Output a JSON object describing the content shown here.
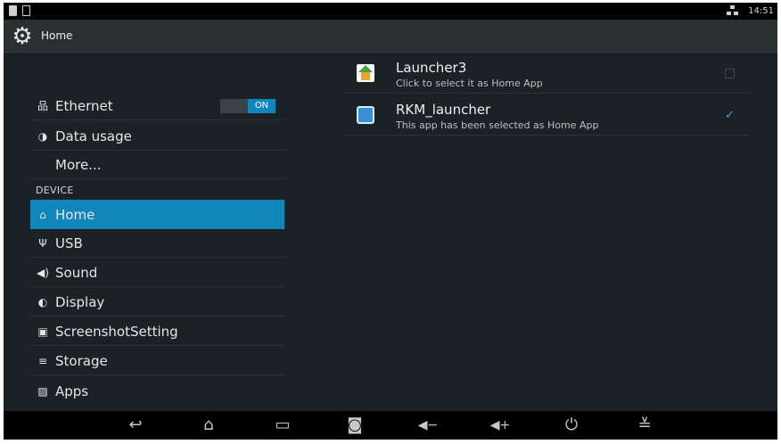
{
  "status_bar": {
    "left_icons": [
      "sd-card-icon",
      "image-notification-icon"
    ],
    "network_icon": "ethernet-icon",
    "time": "14:51"
  },
  "action_bar": {
    "icon": "settings-gear-icon",
    "title": "Home"
  },
  "settings_list": {
    "items": [
      {
        "icon": "ethernet-icon",
        "glyph": "品",
        "label": "Ethernet",
        "toggle": "ON"
      },
      {
        "icon": "data-usage-icon",
        "glyph": "◑",
        "label": "Data usage"
      },
      {
        "icon": "",
        "glyph": "",
        "label": "More..."
      }
    ],
    "device_header": "DEVICE",
    "device_items": [
      {
        "icon": "home-icon",
        "glyph": "⌂",
        "label": "Home",
        "selected": true
      },
      {
        "icon": "usb-icon",
        "glyph": "Ψ",
        "label": "USB"
      },
      {
        "icon": "sound-icon",
        "glyph": "◀)",
        "label": "Sound"
      },
      {
        "icon": "display-icon",
        "glyph": "◐",
        "label": "Display"
      },
      {
        "icon": "screenshot-icon",
        "glyph": "▣",
        "label": "ScreenshotSetting"
      },
      {
        "icon": "storage-icon",
        "glyph": "≡",
        "label": "Storage"
      },
      {
        "icon": "apps-icon",
        "glyph": "▨",
        "label": "Apps"
      }
    ]
  },
  "home_apps": [
    {
      "icon": "launcher3-app-icon",
      "name": "Launcher3",
      "subtitle": "Click to select it as Home App",
      "checked": false
    },
    {
      "icon": "rkm-launcher-app-icon",
      "name": "RKM_launcher",
      "subtitle": "This app has been selected as Home App",
      "checked": true
    }
  ],
  "nav_bar": [
    {
      "name": "back-icon",
      "glyph": "↩"
    },
    {
      "name": "home-nav-icon",
      "glyph": "⌂"
    },
    {
      "name": "recent-apps-icon",
      "glyph": "▭"
    },
    {
      "name": "screenshot-nav-icon",
      "glyph": "◙"
    },
    {
      "name": "volume-down-icon",
      "glyph": "◀−"
    },
    {
      "name": "volume-up-icon",
      "glyph": "◀+"
    },
    {
      "name": "power-icon",
      "glyph": "⏻"
    },
    {
      "name": "hide-bar-icon",
      "glyph": "≚"
    }
  ],
  "colors": {
    "accent": "#1186b8",
    "background": "#1b2226",
    "checkbox_checked": "#3aa7df"
  }
}
